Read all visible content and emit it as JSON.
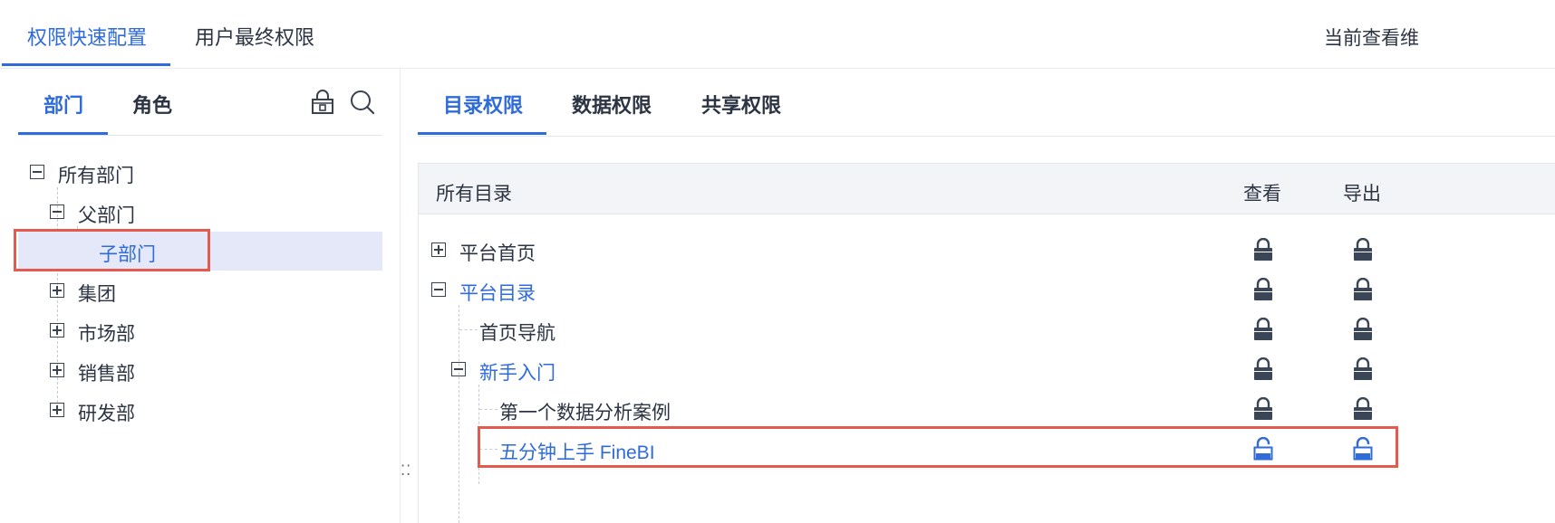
{
  "top_tabs": {
    "quick_config": "权限快速配置",
    "user_final": "用户最终权限",
    "current_view": "当前查看维"
  },
  "left_panel": {
    "tabs": {
      "department": "部门",
      "role": "角色"
    },
    "icons": {
      "lock_tool": "lock-settings-icon",
      "search": "search-icon"
    },
    "tree": {
      "all_departments": "所有部门",
      "parent_department": "父部门",
      "child_department": "子部门",
      "group": "集团",
      "market": "市场部",
      "sales": "销售部",
      "rnd": "研发部"
    }
  },
  "right_panel": {
    "tabs": {
      "catalog": "目录权限",
      "data": "数据权限",
      "share": "共享权限"
    },
    "table": {
      "header": {
        "name": "所有目录",
        "view": "查看",
        "export": "导出"
      },
      "rows": [
        {
          "label": "平台首页",
          "view_lock": "locked",
          "export_lock": "locked"
        },
        {
          "label": "平台目录",
          "view_lock": "locked",
          "export_lock": "locked"
        },
        {
          "label": "首页导航",
          "view_lock": "locked",
          "export_lock": "locked"
        },
        {
          "label": "新手入门",
          "view_lock": "locked",
          "export_lock": "locked"
        },
        {
          "label": "第一个数据分析案例",
          "view_lock": "locked",
          "export_lock": "locked"
        },
        {
          "label": "五分钟上手 FineBI",
          "view_lock": "unlocked",
          "export_lock": "unlocked"
        }
      ]
    }
  },
  "colors": {
    "accent": "#2f6bd9",
    "highlight_border": "#e55a4e",
    "selected_row": "#e4e8f9",
    "lock_locked": "#3a4558",
    "lock_unlocked": "#2f6bd9"
  }
}
